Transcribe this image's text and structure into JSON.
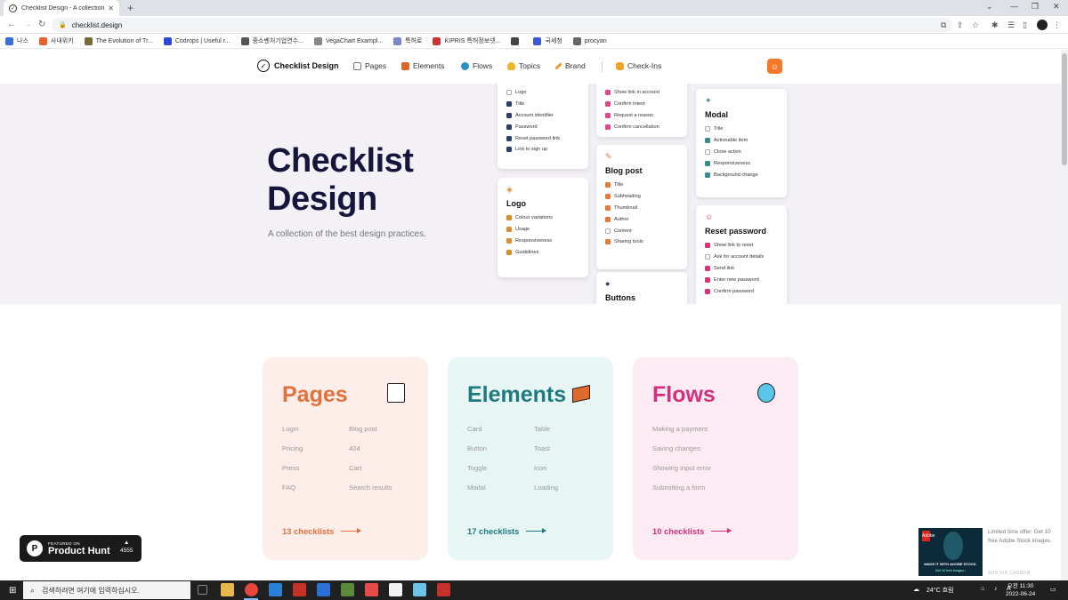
{
  "browser": {
    "tab_title": "Checklist Design - A collection",
    "url": "checklist.design",
    "bookmarks": [
      {
        "label": "나스",
        "color": "#3a6fd8"
      },
      {
        "label": "사내위키",
        "color": "#e8632b"
      },
      {
        "label": "The Evolution of Tr...",
        "color": "#7a6a3a"
      },
      {
        "label": "Codrops | Useful r...",
        "color": "#2a4ad8"
      },
      {
        "label": "중소벤처기업연수...",
        "color": "#555555"
      },
      {
        "label": "VegaChart Exampl...",
        "color": "#888888"
      },
      {
        "label": "특허로",
        "color": "#7a88c8"
      },
      {
        "label": "KIPRIS 특허정보넷...",
        "color": "#c83a3a"
      },
      {
        "label": "",
        "color": "#444444"
      },
      {
        "label": "국세청",
        "color": "#3a5ad8"
      },
      {
        "label": "procyan",
        "color": "#666666"
      }
    ]
  },
  "nav": {
    "brand": "Checklist Design",
    "links": [
      {
        "label": "Pages",
        "icon": "page-icon",
        "color": "#888888"
      },
      {
        "label": "Elements",
        "icon": "brick-icon",
        "color": "#d9662a"
      },
      {
        "label": "Flows",
        "icon": "wave-icon",
        "color": "#2b8fc7"
      },
      {
        "label": "Topics",
        "icon": "bulb-icon",
        "color": "#f2b42a"
      },
      {
        "label": "Brand",
        "icon": "pencil-icon",
        "color": "#e3a22e"
      },
      {
        "label": "Check-Ins",
        "icon": "bag-icon",
        "color": "#e9a62c"
      }
    ]
  },
  "hero": {
    "title": "Checklist Design",
    "subtitle": "A collection of the best design practices.",
    "cards": [
      {
        "title": "",
        "icon": "",
        "items": [
          {
            "label": "Logo",
            "checked": false
          },
          {
            "label": "Title",
            "checked": true
          },
          {
            "label": "Account identifier",
            "checked": true
          },
          {
            "label": "Password",
            "checked": true
          },
          {
            "label": "Reset password link",
            "checked": true
          },
          {
            "label": "Link to sign up",
            "checked": true
          }
        ],
        "color": "#2c3e6b"
      },
      {
        "title": "Logo",
        "icon": "diamond-icon",
        "items": [
          {
            "label": "Colour variations",
            "checked": true
          },
          {
            "label": "Usage",
            "checked": true
          },
          {
            "label": "Responsiveness",
            "checked": true
          },
          {
            "label": "Guidelines",
            "checked": true
          }
        ],
        "color": "#e08a2c"
      },
      {
        "title": "",
        "icon": "",
        "items": [
          {
            "label": "Show link in account",
            "checked": true
          },
          {
            "label": "Confirm intent",
            "checked": true
          },
          {
            "label": "Request a reason",
            "checked": true
          },
          {
            "label": "Confirm cancellation",
            "checked": true
          }
        ],
        "color": "#e0468a"
      },
      {
        "title": "Blog post",
        "icon": "pin-icon",
        "items": [
          {
            "label": "Title",
            "checked": true
          },
          {
            "label": "Subheading",
            "checked": true
          },
          {
            "label": "Thumbnail",
            "checked": true
          },
          {
            "label": "Author",
            "checked": true
          },
          {
            "label": "Content",
            "checked": false
          },
          {
            "label": "Sharing tools",
            "checked": true
          }
        ],
        "color": "#e8773a"
      },
      {
        "title": "Buttons",
        "icon": "ball-icon",
        "items": [],
        "color": "#2c3e6b"
      },
      {
        "title": "Modal",
        "icon": "party-icon",
        "items": [
          {
            "label": "Title",
            "checked": false
          },
          {
            "label": "Actionable item",
            "checked": true
          },
          {
            "label": "Close action",
            "checked": false
          },
          {
            "label": "Responsiveness",
            "checked": true
          },
          {
            "label": "Background change",
            "checked": true
          }
        ],
        "color": "#3b8a8e"
      },
      {
        "title": "Reset password",
        "icon": "smile-icon",
        "items": [
          {
            "label": "Show link to reset",
            "checked": true
          },
          {
            "label": "Ask for account details",
            "checked": false
          },
          {
            "label": "Send link",
            "checked": true
          },
          {
            "label": "Enter new password",
            "checked": true
          },
          {
            "label": "Confirm password",
            "checked": true
          }
        ],
        "color": "#d9337a"
      }
    ]
  },
  "sections": [
    {
      "title": "Pages",
      "icon": "page-icon",
      "color": "#e3703c",
      "bg": "#fdeee9",
      "links": [
        "Login",
        "Blog post",
        "Pricing",
        "404",
        "Press",
        "Cart",
        "FAQ",
        "Search results"
      ],
      "footer": "13 checklists"
    },
    {
      "title": "Elements",
      "icon": "brick-icon",
      "color": "#1f7a7f",
      "bg": "#e7f6f5",
      "links": [
        "Card",
        "Table",
        "Button",
        "Toast",
        "Toggle",
        "Icon",
        "Modal",
        "Loading"
      ],
      "footer": "17 checklists"
    },
    {
      "title": "Flows",
      "icon": "wave-icon",
      "color": "#d32f7f",
      "bg": "#fdebf3",
      "links": [
        "Making a payment",
        "Saving changes",
        "Showing input error",
        "Submitting a form"
      ],
      "footer": "10 checklists"
    }
  ],
  "product_hunt": {
    "featured": "FEATURED ON",
    "name": "Product Hunt",
    "count": "4555"
  },
  "ad": {
    "text": "Limited time offer: Get 10 free Adobe Stock images.",
    "via": "ADS VIA CARBON",
    "banner_title": "MAKE IT WITH ADOBE STOCK.",
    "banner_sub": "Get 10 free images ›",
    "logo": "Adobe"
  },
  "taskbar": {
    "search_placeholder": "검색하려면 여기에 입력하십시오.",
    "weather": "24°C 흐림",
    "lang": "A",
    "time": "오전 11:30",
    "date": "2022-06-24"
  }
}
